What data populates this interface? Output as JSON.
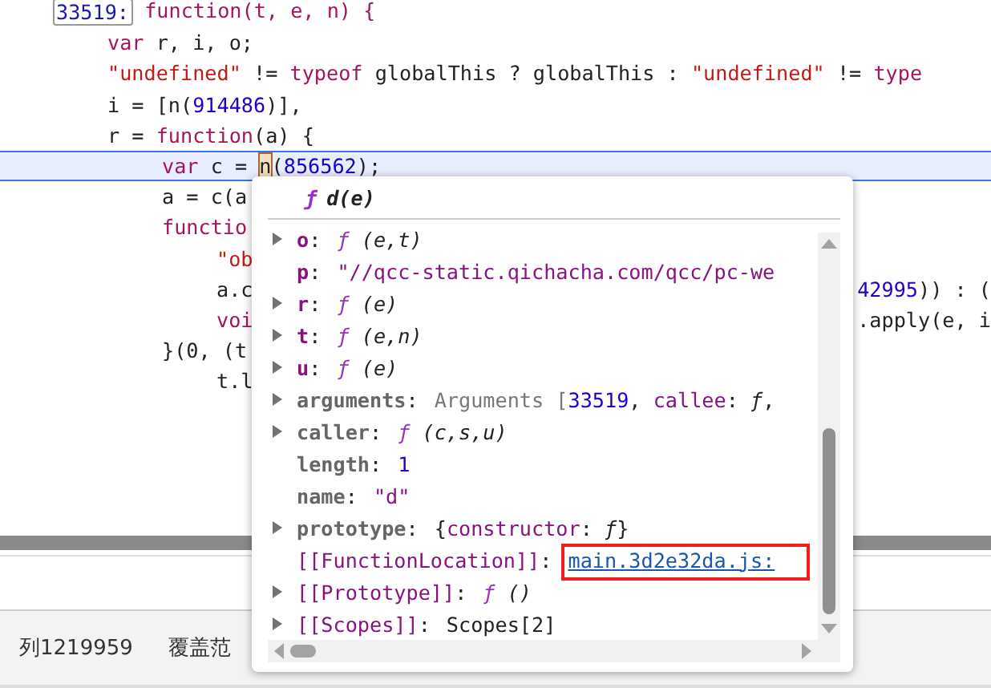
{
  "code_lines": [
    {
      "selected": false,
      "tokens": [
        {
          "text": "33519:",
          "kind": "label"
        },
        {
          "text": " function(t, e, n) {",
          "kind": "kw"
        }
      ],
      "children": [
        {
          "selected": false,
          "tokens": [
            {
              "text": "var",
              "kind": "kw"
            },
            {
              "text": " r, i, o;",
              "kind": "plain"
            }
          ]
        },
        {
          "selected": false,
          "tokens": [
            {
              "text": "\"undefined\"",
              "kind": "str"
            },
            {
              "text": " != ",
              "kind": "plain"
            },
            {
              "text": "typeof",
              "kind": "kw"
            },
            {
              "text": " globalThis ? globalThis : ",
              "kind": "plain"
            },
            {
              "text": "\"undefined\"",
              "kind": "str"
            },
            {
              "text": " != ",
              "kind": "plain"
            },
            {
              "text": "type",
              "kind": "kw"
            }
          ]
        },
        {
          "selected": false,
          "tokens": [
            {
              "text": "i = [n(",
              "kind": "plain"
            },
            {
              "text": "914486",
              "kind": "num"
            },
            {
              "text": ")],",
              "kind": "plain"
            }
          ]
        },
        {
          "selected": false,
          "tokens": [
            {
              "text": "r = ",
              "kind": "plain"
            },
            {
              "text": "function",
              "kind": "kw"
            },
            {
              "text": "(a) {",
              "kind": "plain"
            }
          ],
          "children": [
            {
              "selected": true,
              "tokens": [
                {
                  "text": "var",
                  "kind": "kw"
                },
                {
                  "text": " c = ",
                  "kind": "plain"
                },
                {
                  "text": "n",
                  "kind": "hover"
                },
                {
                  "text": "(",
                  "kind": "plain"
                },
                {
                  "text": "856562",
                  "kind": "num"
                },
                {
                  "text": ");",
                  "kind": "plain"
                }
              ]
            },
            {
              "selected": false,
              "tokens": [
                {
                  "text": "a = c(a",
                  "kind": "plain"
                }
              ]
            },
            {
              "selected": false,
              "tokens": [
                {
                  "text": "functio",
                  "kind": "kw"
                }
              ],
              "children": [
                {
                  "selected": false,
                  "tokens": [
                    {
                      "text": "\"ob",
                      "kind": "str"
                    }
                  ]
                },
                {
                  "selected": false,
                  "tokens": [
                    {
                      "text": "a.c",
                      "kind": "plain"
                    }
                  ],
                  "right": [
                    {
                      "text": "42995",
                      "kind": "num"
                    },
                    {
                      "text": ")) : (",
                      "kind": "plain"
                    }
                  ]
                },
                {
                  "selected": false,
                  "tokens": [
                    {
                      "text": "voi",
                      "kind": "kw"
                    }
                  ],
                  "right": [
                    {
                      "text": ".apply(e, i",
                      "kind": "plain"
                    }
                  ]
                }
              ]
            },
            {
              "selected": false,
              "tokens": [
                {
                  "text": "}(0, (t",
                  "kind": "plain"
                }
              ],
              "children": [
                {
                  "selected": false,
                  "tokens": [
                    {
                      "text": "t.l",
                      "kind": "plain"
                    }
                  ]
                }
              ]
            }
          ]
        }
      ]
    }
  ],
  "popover": {
    "title_icon": "ƒ",
    "title": "d(e)",
    "rows": [
      {
        "expandable": true,
        "key": "o",
        "kind": "own",
        "value": [
          {
            "text": ":",
            "kind": "plain"
          },
          {
            "text": "ƒ",
            "kind": "fn"
          },
          {
            "text": " (e,t)",
            "kind": "sig"
          }
        ]
      },
      {
        "expandable": false,
        "key": "p",
        "kind": "own",
        "value": [
          {
            "text": ":",
            "kind": "plain"
          },
          {
            "text": "\"//qcc-static.qichacha.com/qcc/pc-we",
            "kind": "str"
          }
        ]
      },
      {
        "expandable": true,
        "key": "r",
        "kind": "own",
        "value": [
          {
            "text": ":",
            "kind": "plain"
          },
          {
            "text": "ƒ",
            "kind": "fn"
          },
          {
            "text": " (e)",
            "kind": "sig"
          }
        ]
      },
      {
        "expandable": true,
        "key": "t",
        "kind": "own",
        "value": [
          {
            "text": ":",
            "kind": "plain"
          },
          {
            "text": "ƒ",
            "kind": "fn"
          },
          {
            "text": " (e,n)",
            "kind": "sig"
          }
        ]
      },
      {
        "expandable": true,
        "key": "u",
        "kind": "own",
        "value": [
          {
            "text": ":",
            "kind": "plain"
          },
          {
            "text": "ƒ",
            "kind": "fn"
          },
          {
            "text": " (e)",
            "kind": "sig"
          }
        ]
      },
      {
        "expandable": true,
        "key": "arguments",
        "kind": "builtin",
        "value": [
          {
            "text": ":",
            "kind": "plain"
          },
          {
            "text": "Arguments [",
            "kind": "dim"
          },
          {
            "text": "33519",
            "kind": "num"
          },
          {
            "text": ", ",
            "kind": "plain"
          },
          {
            "text": "callee",
            "kind": "prop"
          },
          {
            "text": ": ",
            "kind": "plain"
          },
          {
            "text": "ƒ",
            "kind": "sig"
          },
          {
            "text": ",",
            "kind": "plain"
          }
        ]
      },
      {
        "expandable": true,
        "key": "caller",
        "kind": "builtin",
        "value": [
          {
            "text": ":",
            "kind": "plain"
          },
          {
            "text": "ƒ",
            "kind": "fn"
          },
          {
            "text": " (c,s,u)",
            "kind": "sig"
          }
        ]
      },
      {
        "expandable": false,
        "key": "length",
        "kind": "builtin",
        "value": [
          {
            "text": ":",
            "kind": "plain"
          },
          {
            "text": "1",
            "kind": "num"
          }
        ]
      },
      {
        "expandable": false,
        "key": "name",
        "kind": "builtin",
        "value": [
          {
            "text": ":",
            "kind": "plain"
          },
          {
            "text": "\"d\"",
            "kind": "str"
          }
        ]
      },
      {
        "expandable": true,
        "key": "prototype",
        "kind": "builtin",
        "value": [
          {
            "text": ":",
            "kind": "plain"
          },
          {
            "text": "{",
            "kind": "plain"
          },
          {
            "text": "constructor",
            "kind": "prop"
          },
          {
            "text": ": ",
            "kind": "plain"
          },
          {
            "text": "ƒ",
            "kind": "sig"
          },
          {
            "text": "}",
            "kind": "plain"
          }
        ]
      },
      {
        "expandable": false,
        "key": "[[FunctionLocation]]",
        "kind": "internal",
        "value": [
          {
            "text": ":",
            "kind": "plain"
          },
          {
            "text": "main.3d2e32da.js:",
            "kind": "link"
          }
        ]
      },
      {
        "expandable": true,
        "key": "[[Prototype]]",
        "kind": "internal",
        "value": [
          {
            "text": ":",
            "kind": "plain"
          },
          {
            "text": "ƒ",
            "kind": "fn"
          },
          {
            "text": " ()",
            "kind": "sig"
          }
        ]
      },
      {
        "expandable": true,
        "key": "[[Scopes]]",
        "kind": "internal",
        "value": [
          {
            "text": ":",
            "kind": "plain"
          },
          {
            "text": "Scopes[2]",
            "kind": "plain"
          }
        ]
      }
    ]
  },
  "status_bar": {
    "position": "列1219959",
    "coverage": "覆盖范"
  }
}
